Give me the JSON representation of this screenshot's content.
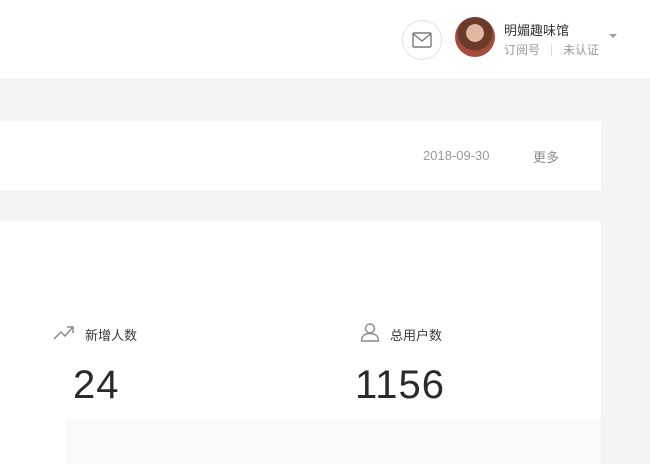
{
  "header": {
    "mail_icon": "mail-icon",
    "avatar": "avatar-photo",
    "account_name": "明媚趣味馆",
    "account_type": "订阅号",
    "verification": "未认证",
    "dropdown_icon": "caret-down-icon"
  },
  "notice": {
    "date": "2018-09-30",
    "more_label": "更多"
  },
  "stats": [
    {
      "icon": "trend-up-icon",
      "label": "新增人数",
      "value": "24"
    },
    {
      "icon": "user-icon",
      "label": "总用户数",
      "value": "1156"
    }
  ],
  "colors": {
    "background": "#f4f4f5",
    "card": "#ffffff",
    "muted_text": "#9a9a9a"
  }
}
